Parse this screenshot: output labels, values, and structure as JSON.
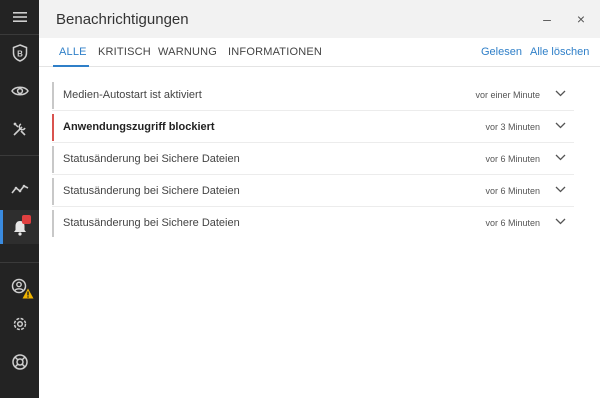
{
  "window": {
    "title": "Benachrichtigungen",
    "minimize_label": "–",
    "close_label": "×"
  },
  "tabs": [
    {
      "label": "ALLE",
      "active": true
    },
    {
      "label": "KRITISCH",
      "active": false
    },
    {
      "label": "WARNUNG",
      "active": false
    },
    {
      "label": "INFORMATIONEN",
      "active": false
    }
  ],
  "actions": {
    "mark_read": "Gelesen",
    "delete_all": "Alle löschen"
  },
  "sidebar": {
    "items": [
      {
        "icon": "menu-icon"
      },
      {
        "icon": "shield-b-icon"
      },
      {
        "icon": "eye-icon"
      },
      {
        "icon": "tools-icon"
      },
      {
        "icon": "activity-icon"
      },
      {
        "icon": "bell-icon",
        "active": true,
        "badge": true
      },
      {
        "icon": "account-icon",
        "warning": true
      },
      {
        "icon": "gear-icon"
      },
      {
        "icon": "lifebuoy-icon"
      }
    ]
  },
  "notifications": [
    {
      "text": "Medien-Autostart ist aktiviert",
      "time": "vor einer Minute",
      "severity": "info",
      "bold": false
    },
    {
      "text": "Anwendungszugriff blockiert",
      "time": "vor 3 Minuten",
      "severity": "critical",
      "bold": true
    },
    {
      "text": "Statusänderung bei Sichere Dateien",
      "time": "vor 6 Minuten",
      "severity": "info",
      "bold": false
    },
    {
      "text": "Statusänderung bei Sichere Dateien",
      "time": "vor 6 Minuten",
      "severity": "info",
      "bold": false
    },
    {
      "text": "Statusänderung bei Sichere Dateien",
      "time": "vor 6 Minuten",
      "severity": "info",
      "bold": false
    }
  ],
  "colors": {
    "sidebar_bg": "#232323",
    "accent": "#2f7fc8",
    "critical": "#d9534f",
    "warning": "#f0b400"
  }
}
